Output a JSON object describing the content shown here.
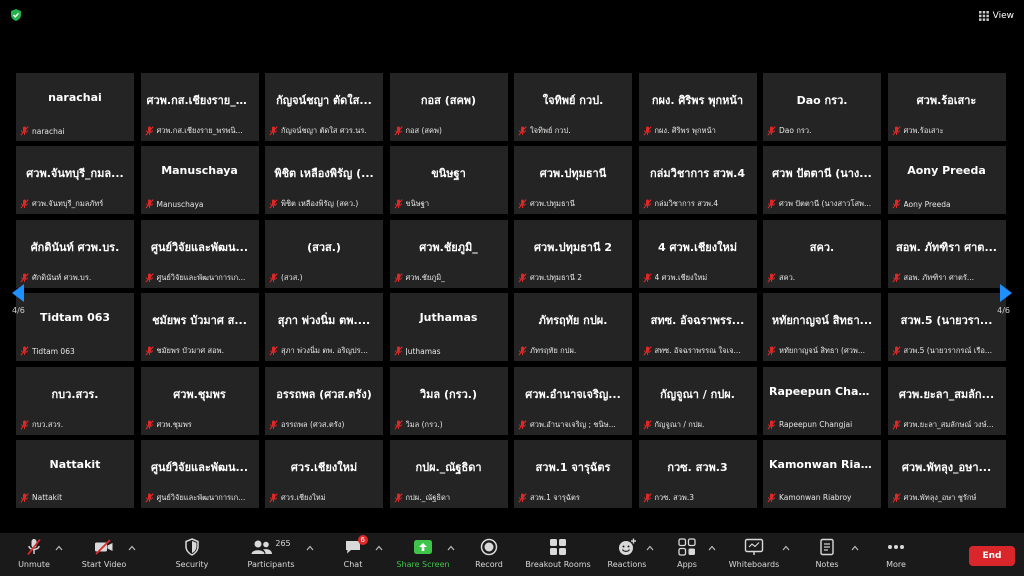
{
  "top": {
    "view_label": "View"
  },
  "pagination": {
    "left": "4/6",
    "right": "4/6"
  },
  "participants": [
    {
      "name": "narachai",
      "label": "narachai"
    },
    {
      "name": "ศวพ.กส.เชียงราย_พรพน...",
      "label": "ศวพ.กส.เชียงราย_พรพนิ..."
    },
    {
      "name": "กัญจน์ชญา ตัดใส...",
      "label": "กัญจน์ชญา ตัดใส ศวร.นร."
    },
    {
      "name": "กอส (สคพ)",
      "label": "กอส (สคพ)"
    },
    {
      "name": "ใจทิพย์ กวป.",
      "label": "ใจทิพย์ กวป."
    },
    {
      "name": "กผง. ศิริพร พุกหน้า",
      "label": "กผง. ศิริพร พุกหน้า"
    },
    {
      "name": "Dao กรว.",
      "label": "Dao กรว."
    },
    {
      "name": "ศวพ.ร้อเสาะ",
      "label": "ศวพ.ร้อเสาะ"
    },
    {
      "name": "ศวพ.จันทบุรี_กมล...",
      "label": "ศวพ.จันทบุรี_กมลภัทร์"
    },
    {
      "name": "Manuschaya",
      "label": "Manuschaya"
    },
    {
      "name": "พิชิต เหลืองพิรัญ (...",
      "label": "พิชิต เหลืองพิรัญ (สคว.)"
    },
    {
      "name": "ขนิษฐา",
      "label": "ขนิษฐา"
    },
    {
      "name": "ศวพ.ปทุมธานี",
      "label": "ศวพ.ปทุมธานี"
    },
    {
      "name": "กล่มวิชาการ สวพ.4",
      "label": "กล่มวิชาการ สวพ.4"
    },
    {
      "name": "ศวพ ปัตตานี (นาง...",
      "label": "ศวพ ปัตตานี (นางสาวโสพ..."
    },
    {
      "name": "Aony Preeda",
      "label": "Aony Preeda"
    },
    {
      "name": "ศักดินันท์ ศวพ.บร.",
      "label": "ศักดินันท์ ศวพ.บร."
    },
    {
      "name": "ศูนย์วิจัยและพัฒน...",
      "label": "ศูนย์วิจัยและพัฒนาการเก..."
    },
    {
      "name": "(สวส.)",
      "label": "(สวส.)"
    },
    {
      "name": "ศวพ.ชัยภูมิ_",
      "label": "ศวพ.ชัยภูมิ_"
    },
    {
      "name": "ศวพ.ปทุมธานี 2",
      "label": "ศวพ.ปทุมธานี 2"
    },
    {
      "name": "4 ศวพ.เชียงใหม่",
      "label": "4 ศวพ.เชียงใหม่"
    },
    {
      "name": "สคว.",
      "label": "สคว."
    },
    {
      "name": "สอพ. ภัทฑิรา ศาต...",
      "label": "สอพ. ภัทฑิรา ศาตรั..."
    },
    {
      "name": "Tidtam 063",
      "label": "Tidtam 063"
    },
    {
      "name": "ชมัยพร บัวมาศ ส...",
      "label": "ชมัยพร บัวมาศ สอพ."
    },
    {
      "name": "สุภา พ่วงนิ่ม ตพ....",
      "label": "สุภา พ่วงนิ่ม ตพ. อริญปร..."
    },
    {
      "name": "Juthamas",
      "label": "Juthamas"
    },
    {
      "name": "ภัทรฤทัย กปผ.",
      "label": "ภัทรฤทัย กปผ."
    },
    {
      "name": "สทซ. อัจฉราพรร...",
      "label": "สทซ. อัจฉราพรรณ ใจเจ..."
    },
    {
      "name": "หทัยกาญจน์ สิทธา...",
      "label": "หทัยกาญจน์ สิทธา (ศวพ..."
    },
    {
      "name": "สวพ.5 (นายวรา...",
      "label": "สวพ.5 (นายวรากรณ์ เรือ..."
    },
    {
      "name": "กบว.สวร.",
      "label": "กบว.สวร."
    },
    {
      "name": "ศวพ.ชุมพร",
      "label": "ศวพ.ชุมพร"
    },
    {
      "name": "อรรถพล (ศวส.ตรัง)",
      "label": "อรรถพล (ศวส.ตรัง)"
    },
    {
      "name": "วิมล (กรว.)",
      "label": "วิมล (กรว.)"
    },
    {
      "name": "ศวพ.อำนาจเจริญ...",
      "label": "ศวพ.อำนาจเจริญ ; ชนิษ..."
    },
    {
      "name": "กัญจูณา / กปผ.",
      "label": "กัญจูณา / กปผ."
    },
    {
      "name": "Rapeepun Chan...",
      "label": "Rapeepun Changjai"
    },
    {
      "name": "ศวพ.ยะลา_สมลัก...",
      "label": "ศวพ.ยะลา_สมลักษณ์ วงษ์..."
    },
    {
      "name": "Nattakit",
      "label": "Nattakit"
    },
    {
      "name": "ศูนย์วิจัยและพัฒน...",
      "label": "ศูนย์วิจัยและพัฒนาการเก..."
    },
    {
      "name": "ศวร.เชียงใหม่",
      "label": "ศวร.เชียงใหม่"
    },
    {
      "name": "กปผ._ณัฐธิดา",
      "label": "กปผ._ณัฐธิดา"
    },
    {
      "name": "สวพ.1 จารุฉัตร",
      "label": "สวพ.1 จารุฉัตร"
    },
    {
      "name": "กวซ. สวพ.3",
      "label": "กวซ. สวพ.3"
    },
    {
      "name": "Kamonwan Riab...",
      "label": "Kamonwan Riabroy"
    },
    {
      "name": "ศวพ.พัทลุง_อษา...",
      "label": "ศวพ.พัทลุง_อษา ชูรักษ์"
    }
  ],
  "toolbar": {
    "unmute": "Unmute",
    "start_video": "Start Video",
    "security": "Security",
    "participants": "Participants",
    "participants_count": "265",
    "chat": "Chat",
    "chat_badge": "6",
    "share_screen": "Share Screen",
    "record": "Record",
    "breakout_rooms": "Breakout Rooms",
    "reactions": "Reactions",
    "apps": "Apps",
    "whiteboards": "Whiteboards",
    "notes": "Notes",
    "more": "More",
    "end": "End"
  },
  "colors": {
    "accent_green": "#3ec34b",
    "end_red": "#d9262b",
    "muted_red": "#e02828",
    "tile_bg": "#242424"
  }
}
